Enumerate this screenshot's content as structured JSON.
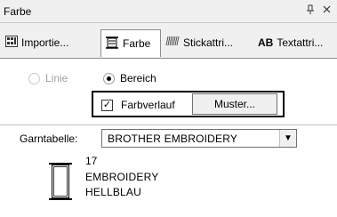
{
  "window": {
    "title": "Farbe",
    "pin_icon": "pin-icon",
    "close_icon": "close-icon"
  },
  "tabs": [
    {
      "label": "Importie...",
      "icon": "import-icon"
    },
    {
      "label": "Farbe",
      "icon": "color-spool-icon",
      "active": true
    },
    {
      "label": "Stickattri...",
      "icon": "stitch-attr-icon"
    },
    {
      "label": "Textattri...",
      "icon": "text-attr-icon",
      "icon_text": "AB"
    }
  ],
  "options": {
    "linie_label": "Linie",
    "bereich_label": "Bereich",
    "farbverlauf_label": "Farbverlauf",
    "muster_label": "Muster..."
  },
  "garn": {
    "label": "Garntabelle:",
    "selected": "BROTHER EMBROIDERY"
  },
  "color": {
    "number": "17",
    "brand": "EMBROIDERY",
    "name": "HELLBLAU"
  }
}
